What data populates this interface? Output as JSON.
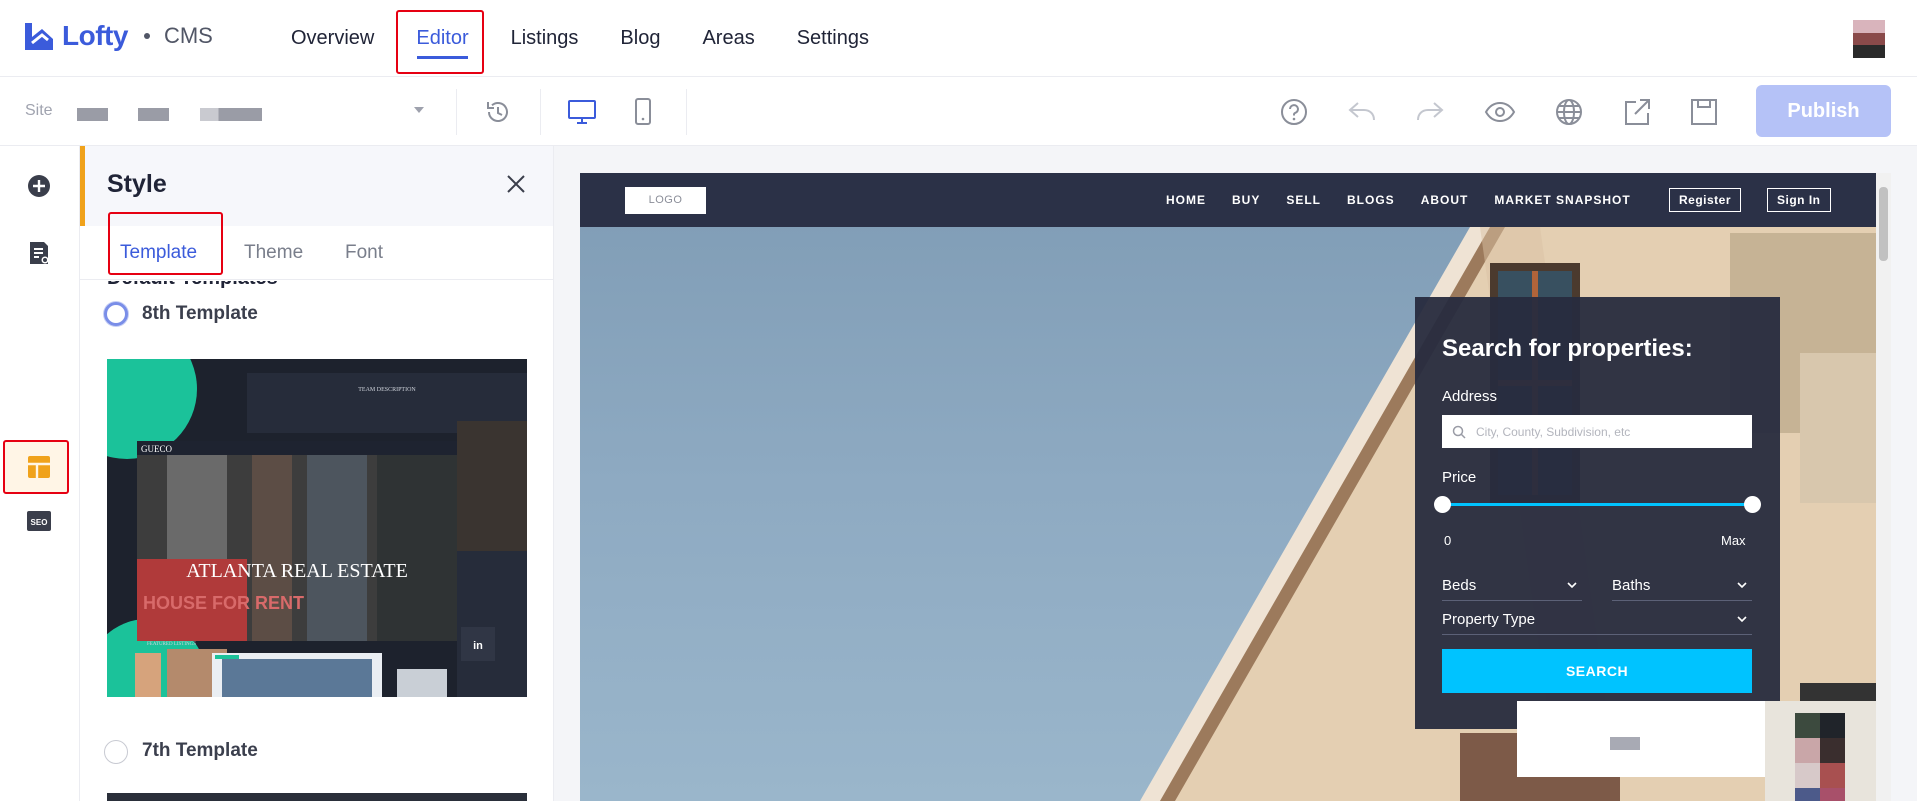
{
  "app": {
    "brand": "Lofty",
    "product": "CMS"
  },
  "nav": {
    "tabs": [
      {
        "label": "Overview"
      },
      {
        "label": "Editor",
        "active": true
      },
      {
        "label": "Listings"
      },
      {
        "label": "Blog"
      },
      {
        "label": "Areas"
      },
      {
        "label": "Settings"
      }
    ]
  },
  "toolbar": {
    "site_label": "Site",
    "publish_label": "Publish",
    "icons": [
      "history-icon",
      "desktop-icon",
      "mobile-icon",
      "help-icon",
      "undo-icon",
      "redo-icon",
      "preview-icon",
      "globe-icon",
      "export-icon",
      "save-icon"
    ]
  },
  "rail": {
    "icons": [
      "add-icon",
      "pages-icon",
      "style-icon",
      "seo-icon"
    ],
    "seo_text": "SEO",
    "active_color": "#f0a21b"
  },
  "style_panel": {
    "title": "Style",
    "tabs": [
      {
        "label": "Template",
        "active": true
      },
      {
        "label": "Theme"
      },
      {
        "label": "Font"
      }
    ],
    "section_label": "Default Templates",
    "templates": [
      {
        "name": "8th Template",
        "selected": true
      },
      {
        "name": "7th Template",
        "selected": false
      }
    ],
    "thumbnail": {
      "headline": "ATLANTA REAL ESTATE",
      "brand": "GUECO",
      "team": "TEAM DESCRIPTION",
      "featured": "FEATURED LISTINGS",
      "sign": "HOUSE FOR RENT"
    }
  },
  "preview": {
    "logo": "LOGO",
    "menu": [
      "HOME",
      "BUY",
      "SELL",
      "BLOGS",
      "ABOUT",
      "MARKET SNAPSHOT"
    ],
    "register": "Register",
    "sign_in": "Sign In",
    "search": {
      "title": "Search for properties:",
      "address_label": "Address",
      "address_placeholder": "City, County, Subdivision, etc",
      "price_label": "Price",
      "price_min": "0",
      "price_max": "Max",
      "beds_label": "Beds",
      "baths_label": "Baths",
      "property_type_label": "Property Type",
      "button_label": "SEARCH"
    }
  },
  "colors": {
    "accent": "#3b5bdb",
    "publish_disabled": "#b5c2f7",
    "search_button": "#00c3ff",
    "site_nav": "#2b3147",
    "annotation_red": "#e60012"
  }
}
